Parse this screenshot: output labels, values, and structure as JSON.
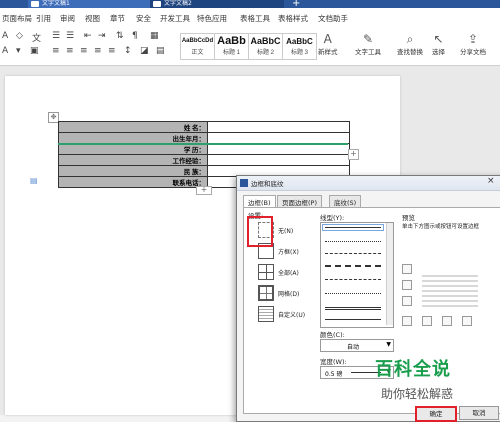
{
  "titlebar": {
    "tabs": [
      "文字文稿1",
      "文字文稿2"
    ],
    "plus": "+"
  },
  "menu": [
    "页面布局",
    "引用",
    "审阅",
    "视图",
    "章节",
    "安全",
    "开发工具",
    "特色应用",
    "表格工具",
    "表格样式",
    "文档助手"
  ],
  "ribbon": {
    "styles": [
      {
        "sample": "AaBbCcDd",
        "name": "正文"
      },
      {
        "sample": "AaBb",
        "name": "标题 1"
      },
      {
        "sample": "AaBbC",
        "name": "标题 2"
      },
      {
        "sample": "AaBbC",
        "name": "标题 3"
      }
    ],
    "tools": [
      "新样式",
      "文字工具",
      "查找替换",
      "选择",
      "分享文档"
    ]
  },
  "document": {
    "rows": [
      "姓  名：",
      "出生年月：",
      "学  历：",
      "工作经验：",
      "民  族：",
      "联系电话："
    ],
    "move_handle": "✥",
    "add_column": "+",
    "add_row": "+"
  },
  "dialog": {
    "title": "边框和底纹",
    "close": "×",
    "tabs": [
      "边框(B)",
      "页面边框(P)",
      "底纹(S)"
    ],
    "setting_label": "设置:",
    "settings": [
      "无(N)",
      "方框(X)",
      "全部(A)",
      "网格(D)",
      "自定义(U)"
    ],
    "line_style_label": "线型(Y):",
    "color_label": "颜色(C):",
    "color_value": "自动",
    "width_label": "宽度(W):",
    "width_value": "0.5 磅",
    "preview_label": "预览",
    "preview_hint": "单击下方图示或按钮可设置边框",
    "ok": "确定",
    "cancel": "取消"
  },
  "watermark": {
    "title": "百科全说",
    "subtitle": "助你轻松解惑"
  },
  "colors": {
    "accent": "#2b579a",
    "highlight": "#e0202b",
    "watermark": "#1a9e4d",
    "label_fill": "#b4b4b4"
  }
}
